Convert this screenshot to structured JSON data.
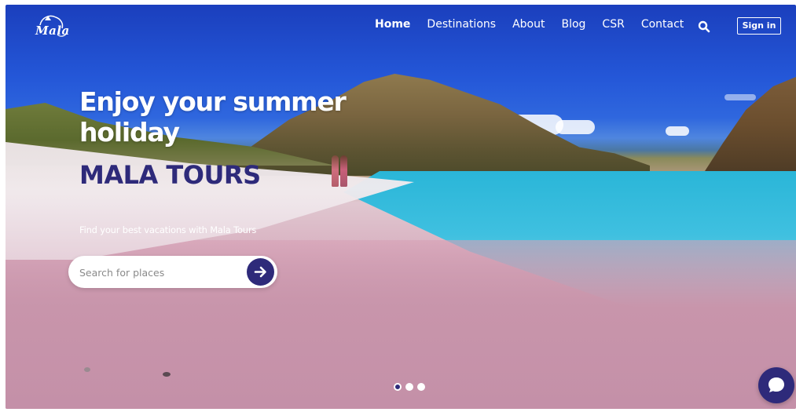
{
  "app": {
    "brand_logo": "Mala"
  },
  "nav": {
    "items": [
      {
        "label": "Home",
        "active": true
      },
      {
        "label": "Destinations",
        "active": false
      },
      {
        "label": "About",
        "active": false
      },
      {
        "label": "Blog",
        "active": false
      },
      {
        "label": "CSR",
        "active": false
      },
      {
        "label": "Contact",
        "active": false
      }
    ],
    "search_icon": "search-icon",
    "signin_label": "Sign in"
  },
  "hero": {
    "title_line1": "Enjoy your summer",
    "title_line2": "holiday",
    "brand": "MALA TOURS",
    "subtitle": "Find your best vacations with Mala Tours",
    "search": {
      "placeholder": "Search for places",
      "value": "",
      "go_icon": "arrow-right-icon"
    }
  },
  "carousel": {
    "slides": 3,
    "active_index": 0
  },
  "chat": {
    "icon": "chat-bubble-icon"
  },
  "colors": {
    "brand_navy": "#2e2a7a",
    "white": "#ffffff"
  }
}
